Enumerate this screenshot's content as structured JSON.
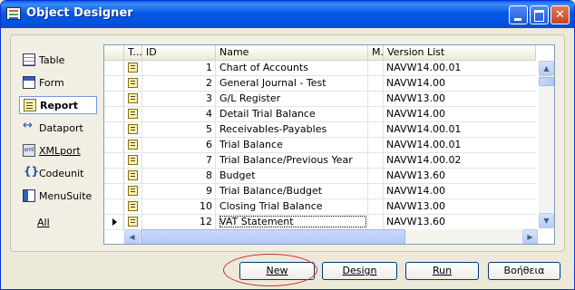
{
  "window": {
    "title": "Object Designer"
  },
  "titlebar_buttons": {
    "minimize": "",
    "maximize": "",
    "close": "✕"
  },
  "nav": [
    {
      "label": "Table",
      "icon": "table-icon"
    },
    {
      "label": "Form",
      "icon": "form-icon"
    },
    {
      "label": "Report",
      "icon": "report-icon",
      "active": true
    },
    {
      "label": "Dataport",
      "icon": "dataport-icon"
    },
    {
      "label": "XMLport",
      "icon": "xmlport-icon"
    },
    {
      "label": "Codeunit",
      "icon": "codeunit-icon"
    },
    {
      "label": "MenuSuite",
      "icon": "menusuite-icon"
    },
    {
      "label": "All"
    }
  ],
  "grid": {
    "columns": {
      "type": "T...",
      "id": "ID",
      "name": "Name",
      "modified": "M...",
      "version": "Version List"
    },
    "rows": [
      {
        "id": "1",
        "name": "Chart of Accounts",
        "version": "NAVW14.00.01"
      },
      {
        "id": "2",
        "name": "General Journal - Test",
        "version": "NAVW14.00"
      },
      {
        "id": "3",
        "name": "G/L Register",
        "version": "NAVW13.00"
      },
      {
        "id": "4",
        "name": "Detail Trial Balance",
        "version": "NAVW14.00"
      },
      {
        "id": "5",
        "name": "Receivables-Payables",
        "version": "NAVW14.00.01"
      },
      {
        "id": "6",
        "name": "Trial Balance",
        "version": "NAVW14.00.01"
      },
      {
        "id": "7",
        "name": "Trial Balance/Previous Year",
        "version": "NAVW14.00.02"
      },
      {
        "id": "8",
        "name": "Budget",
        "version": "NAVW13.60"
      },
      {
        "id": "9",
        "name": "Trial Balance/Budget",
        "version": "NAVW14.00"
      },
      {
        "id": "10",
        "name": "Closing Trial Balance",
        "version": "NAVW13.00"
      },
      {
        "id": "12",
        "name": "VAT Statement",
        "version": "NAVW13.60",
        "current": true
      }
    ]
  },
  "buttons": {
    "new": "New",
    "design": "Design",
    "run": "Run",
    "help": "Βοήθεια"
  },
  "colors": {
    "titlebar": "#0054E3",
    "highlight_ellipse": "#C9302C",
    "panel": "#ECE9D8"
  }
}
